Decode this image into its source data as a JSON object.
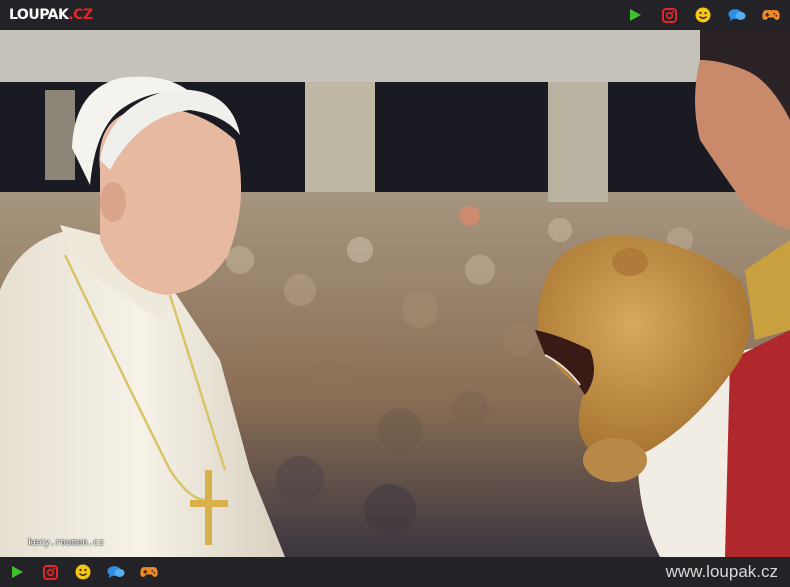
{
  "header": {
    "logo_main": "LOUPAK",
    "logo_tld": ".CZ"
  },
  "nav_icons": [
    {
      "name": "play-icon",
      "color": "#3fbf2f"
    },
    {
      "name": "instagram-icon",
      "color": "#e0262b"
    },
    {
      "name": "smiley-icon",
      "color": "#f5c518"
    },
    {
      "name": "chat-icon",
      "color": "#2f8fe0"
    },
    {
      "name": "gamepad-icon",
      "color": "#f08a24"
    }
  ],
  "photo": {
    "watermark": "kecy.roumen.cz"
  },
  "footer": {
    "site_url": "www.loupak.cz"
  }
}
